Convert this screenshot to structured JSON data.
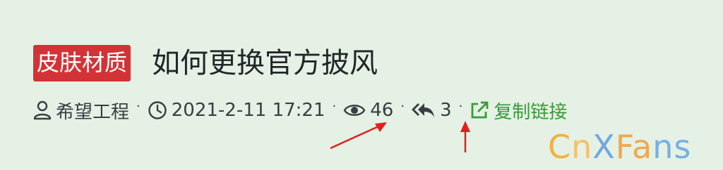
{
  "post": {
    "tag": "皮肤材质",
    "title": "如何更换官方披风",
    "author": "希望工程",
    "datetime": "2021-2-11 17:21",
    "views": "46",
    "replies": "3",
    "copy_link_label": "复制链接",
    "separator": "·"
  },
  "watermark": {
    "text_1": "C",
    "text_2": "n",
    "text_3": "X",
    "text_4": "Fa",
    "text_5": "ns"
  },
  "colors": {
    "background": "#e4f1e4",
    "tag_bg": "#d23337",
    "link_green": "#3a9a3a",
    "annotation_arrow": "#e02020"
  },
  "icons": {
    "author": "user-icon",
    "time": "clock-icon",
    "views": "eye-icon",
    "replies": "reply-all-icon",
    "copy": "external-link-icon"
  }
}
